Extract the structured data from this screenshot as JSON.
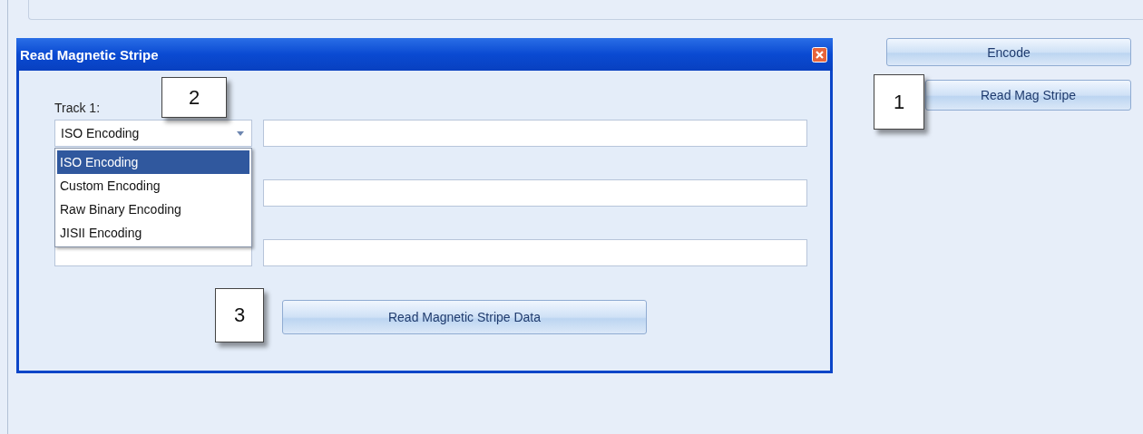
{
  "dialog": {
    "title": "Read Magnetic Stripe",
    "tracks": [
      {
        "kind": "labeled",
        "label": "Track 1:",
        "selection": "ISO Encoding",
        "callout": "2"
      },
      {
        "kind": "covered"
      },
      {
        "kind": "covered"
      }
    ],
    "dropdown": {
      "options": [
        {
          "label": "ISO Encoding",
          "selected": true
        },
        {
          "label": "Custom Encoding",
          "selected": false
        },
        {
          "label": "Raw Binary Encoding",
          "selected": false
        },
        {
          "label": "JISII Encoding",
          "selected": false
        }
      ]
    },
    "action_button": {
      "label": "Read Magnetic Stripe Data",
      "callout": "3"
    }
  },
  "side_buttons": [
    {
      "label": "Encode"
    },
    {
      "label": "Read Mag Stripe",
      "callout": "1"
    }
  ]
}
